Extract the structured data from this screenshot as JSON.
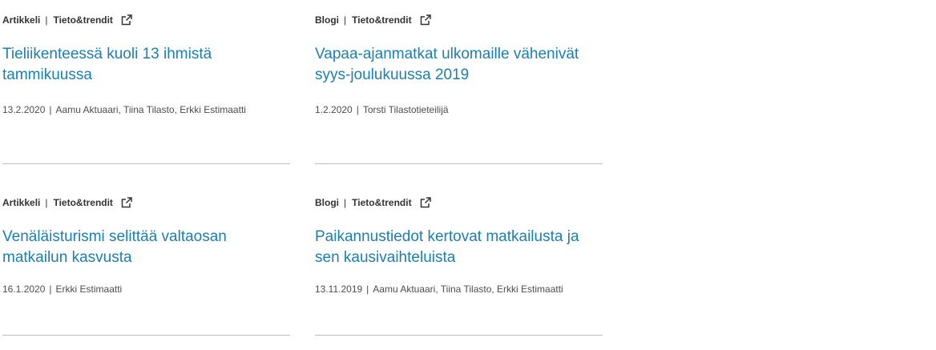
{
  "articles": [
    {
      "type": "Artikkeli",
      "source": "Tieto&trendit",
      "title": "Tieliikenteessä kuoli 13 ihmistä tammikuussa",
      "date": "13.2.2020",
      "authors": "Aamu Aktuaari, Tiina Tilasto, Erkki Estimaatti"
    },
    {
      "type": "Blogi",
      "source": "Tieto&trendit",
      "title": "Vapaa-ajanmatkat ulkomaille vähenivät syys-joulukuussa 2019",
      "date": "1.2.2020",
      "authors": "Torsti Tilastotieteilijä"
    },
    {
      "type": "Artikkeli",
      "source": "Tieto&trendit",
      "title": "Venäläisturismi selittää valtaosan matkailun kasvusta",
      "date": "16.1.2020",
      "authors": "Erkki Estimaatti"
    },
    {
      "type": "Blogi",
      "source": "Tieto&trendit",
      "title": "Paikannustiedot kertovat matkailusta ja sen kausivaihteluista",
      "date": "13.11.2019",
      "authors": "Aamu Aktuaari, Tiina Tilasto, Erkki Estimaatti"
    }
  ],
  "separator": "|",
  "icons": {
    "external": "external-link-icon"
  },
  "colors": {
    "title": "#1a7fb3",
    "text": "#333333",
    "divider": "#bdbdbd"
  }
}
